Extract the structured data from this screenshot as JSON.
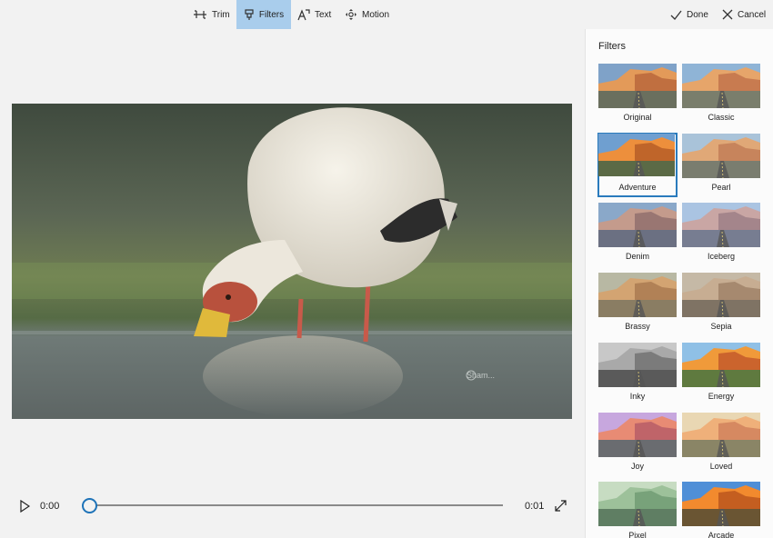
{
  "toolbar": {
    "trim_label": "Trim",
    "filters_label": "Filters",
    "text_label": "Text",
    "motion_label": "Motion",
    "done_label": "Done",
    "cancel_label": "Cancel",
    "active_tool": "Filters"
  },
  "player": {
    "current_time": "0:00",
    "total_time": "0:01",
    "progress": 0,
    "watermark": "Sham..."
  },
  "panel": {
    "title": "Filters",
    "selected_filter": "Adventure",
    "filters": [
      {
        "label": "Original"
      },
      {
        "label": "Classic"
      },
      {
        "label": "Adventure"
      },
      {
        "label": "Pearl"
      },
      {
        "label": "Denim"
      },
      {
        "label": "Iceberg"
      },
      {
        "label": "Brassy"
      },
      {
        "label": "Sepia"
      },
      {
        "label": "Inky"
      },
      {
        "label": "Energy"
      },
      {
        "label": "Joy"
      },
      {
        "label": "Loved"
      },
      {
        "label": "Pixel"
      },
      {
        "label": "Arcade"
      }
    ]
  },
  "colors": {
    "accent": "#2a7bbd",
    "active_tool_bg": "#a9cdec",
    "thumb_ring": "#1e73b8"
  }
}
